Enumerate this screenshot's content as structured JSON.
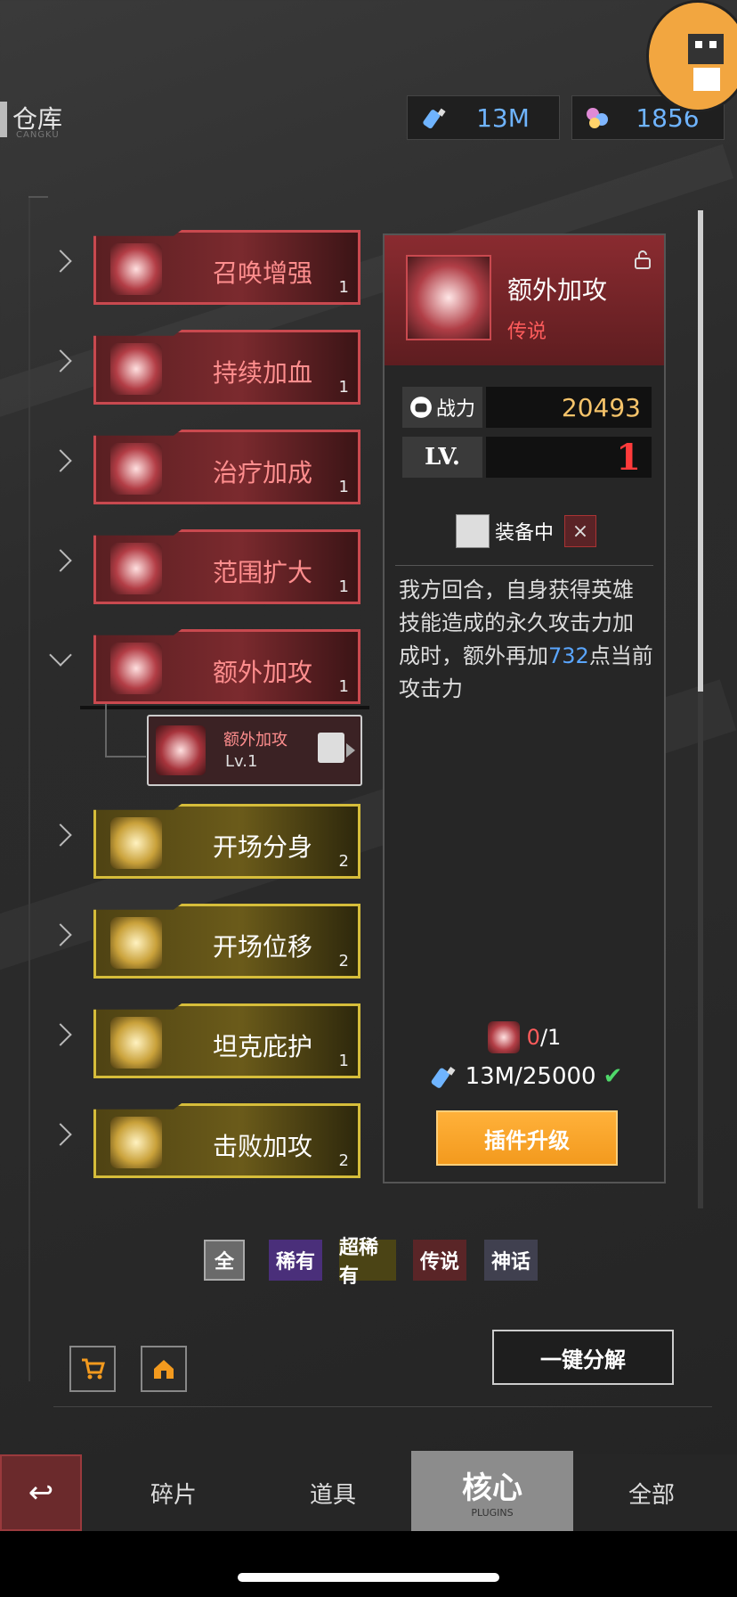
{
  "header": {
    "title": "仓库",
    "subtitle": "CANGKU"
  },
  "resources": [
    {
      "icon": "potion-bottle-icon",
      "value": "13M"
    },
    {
      "icon": "gem-crystal-icon",
      "value": "1856"
    }
  ],
  "list": {
    "items": [
      {
        "name": "召唤增强",
        "count": "1",
        "rarity": "legend",
        "expanded": false
      },
      {
        "name": "持续加血",
        "count": "1",
        "rarity": "legend",
        "expanded": false
      },
      {
        "name": "治疗加成",
        "count": "1",
        "rarity": "legend",
        "expanded": false
      },
      {
        "name": "范围扩大",
        "count": "1",
        "rarity": "legend",
        "expanded": false
      },
      {
        "name": "额外加攻",
        "count": "1",
        "rarity": "legend",
        "expanded": true
      },
      {
        "name": "开场分身",
        "count": "2",
        "rarity": "epic",
        "expanded": false
      },
      {
        "name": "开场位移",
        "count": "2",
        "rarity": "epic",
        "expanded": false
      },
      {
        "name": "坦克庇护",
        "count": "1",
        "rarity": "epic",
        "expanded": false
      },
      {
        "name": "击败加攻",
        "count": "2",
        "rarity": "epic",
        "expanded": false
      }
    ],
    "sub_item": {
      "name": "额外加攻",
      "level": "Lv.1"
    }
  },
  "detail": {
    "name": "额外加攻",
    "rarity": "传说",
    "power_label": "战力",
    "power_value": "20493",
    "level_label": "LV.",
    "level_value": "1",
    "equipped_label": "装备中",
    "close_glyph": "×",
    "desc_part1": "我方回合，自身获得英雄技能造成的永久攻击力加成时，额外再加",
    "desc_highlight": "732",
    "desc_part2": "点当前攻击力",
    "req_count_have": "0",
    "req_count_need": "/1",
    "req_cost": "13M/25000",
    "check_glyph": "✔",
    "upgrade_label": "插件升级"
  },
  "filters": [
    {
      "label": "全",
      "color": "#6a6a6a"
    },
    {
      "label": "稀有",
      "color": "#4a2f7a"
    },
    {
      "label": "超稀有",
      "color": "#4b4415"
    },
    {
      "label": "传说",
      "color": "#5a2527"
    },
    {
      "label": "神话",
      "color": "#40404f"
    }
  ],
  "actions": {
    "dismantle_label": "一键分解"
  },
  "tabs": {
    "back_glyph": "↩",
    "items": [
      {
        "label": "碎片"
      },
      {
        "label": "道具"
      },
      {
        "label": "核心",
        "sub": "PLUGINS",
        "active": true
      },
      {
        "label": "全部"
      }
    ]
  },
  "colors": {
    "legend": "#c9494f",
    "epic": "#d6bd3a",
    "accent_blue": "#6fb4ff",
    "upgrade_orange": "#f5a22a"
  }
}
